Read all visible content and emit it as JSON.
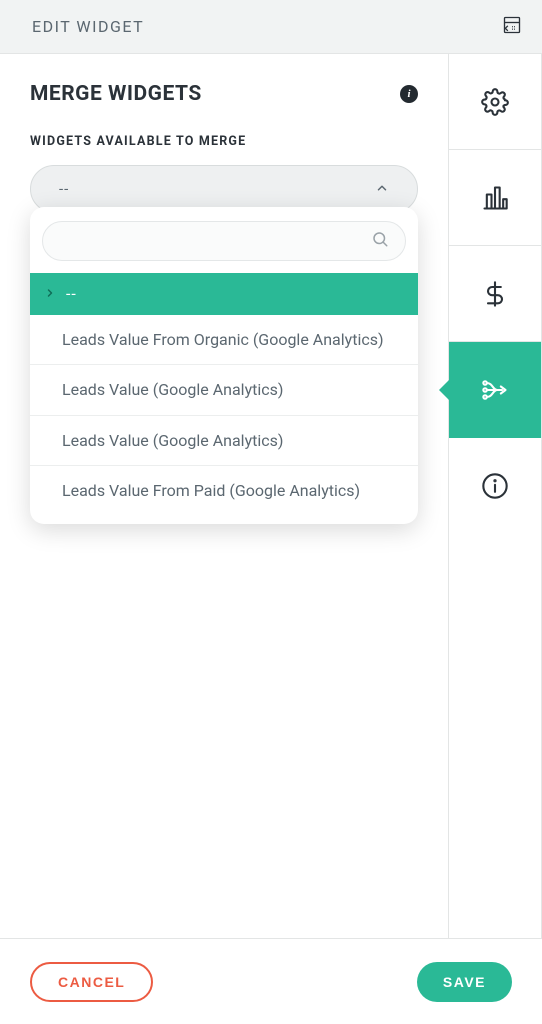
{
  "header": {
    "title": "EDIT WIDGET"
  },
  "section": {
    "title": "MERGE WIDGETS",
    "info_label": "i"
  },
  "merge": {
    "label": "WIDGETS AVAILABLE TO MERGE",
    "selected_value": "--",
    "search_placeholder": "",
    "options": [
      {
        "label": "--",
        "selected": true
      },
      {
        "label": "Leads Value From Organic (Google Analytics)",
        "selected": false
      },
      {
        "label": "Leads Value (Google Analytics)",
        "selected": false
      },
      {
        "label": "Leads Value (Google Analytics)",
        "selected": false
      },
      {
        "label": "Leads Value From Paid (Google Analytics)",
        "selected": false
      }
    ]
  },
  "sidebar": {
    "items": [
      {
        "name": "settings",
        "active": false
      },
      {
        "name": "chart",
        "active": false
      },
      {
        "name": "currency",
        "active": false
      },
      {
        "name": "merge",
        "active": true
      },
      {
        "name": "info",
        "active": false
      }
    ]
  },
  "footer": {
    "cancel": "CANCEL",
    "save": "SAVE"
  }
}
